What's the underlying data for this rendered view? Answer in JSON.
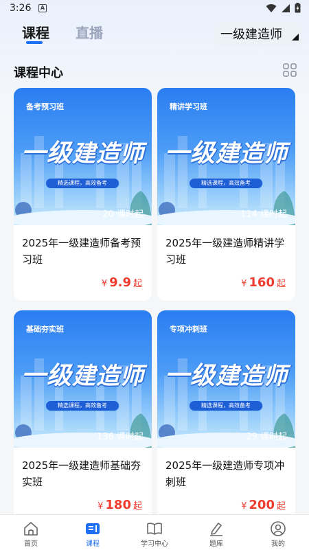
{
  "status_bar": {
    "time": "3:26",
    "notif": "A"
  },
  "header": {
    "tabs": [
      {
        "label": "课程"
      },
      {
        "label": "直播"
      }
    ],
    "exam_select": "一级建造师"
  },
  "section": {
    "title": "课程中心"
  },
  "courses": [
    {
      "tag": "备考预习班",
      "cover_title_a": "一级",
      "cover_title_b": "建造师",
      "slogan": "精选课程，高效备考",
      "lessons": "20 课时起",
      "name": "2025年一级建造师备考预习班",
      "currency": "¥",
      "price": "9.9",
      "suffix": "起"
    },
    {
      "tag": "精讲学习班",
      "cover_title_a": "一级",
      "cover_title_b": "建造师",
      "slogan": "精选课程，高效备考",
      "lessons": "114 课时起",
      "name": "2025年一级建造师精讲学习班",
      "currency": "¥",
      "price": "160",
      "suffix": "起"
    },
    {
      "tag": "基础夯实班",
      "cover_title_a": "一级",
      "cover_title_b": "建造师",
      "slogan": "精选课程，高效备考",
      "lessons": "136 课时起",
      "name": "2025年一级建造师基础夯实班",
      "currency": "¥",
      "price": "180",
      "suffix": "起"
    },
    {
      "tag": "专项冲刺班",
      "cover_title_a": "一级",
      "cover_title_b": "建造师",
      "slogan": "精选课程，高效备考",
      "lessons": "29 课时起",
      "name": "2025年一级建造师专项冲刺班",
      "currency": "¥",
      "price": "200",
      "suffix": "起"
    }
  ],
  "bottom_nav": [
    {
      "label": "首页",
      "icon": "home-icon"
    },
    {
      "label": "课程",
      "icon": "course-icon"
    },
    {
      "label": "学习中心",
      "icon": "book-icon"
    },
    {
      "label": "题库",
      "icon": "pen-icon"
    },
    {
      "label": "我的",
      "icon": "profile-icon"
    }
  ],
  "colors": {
    "accent": "#1e6ff2",
    "price": "#f03c2e"
  }
}
